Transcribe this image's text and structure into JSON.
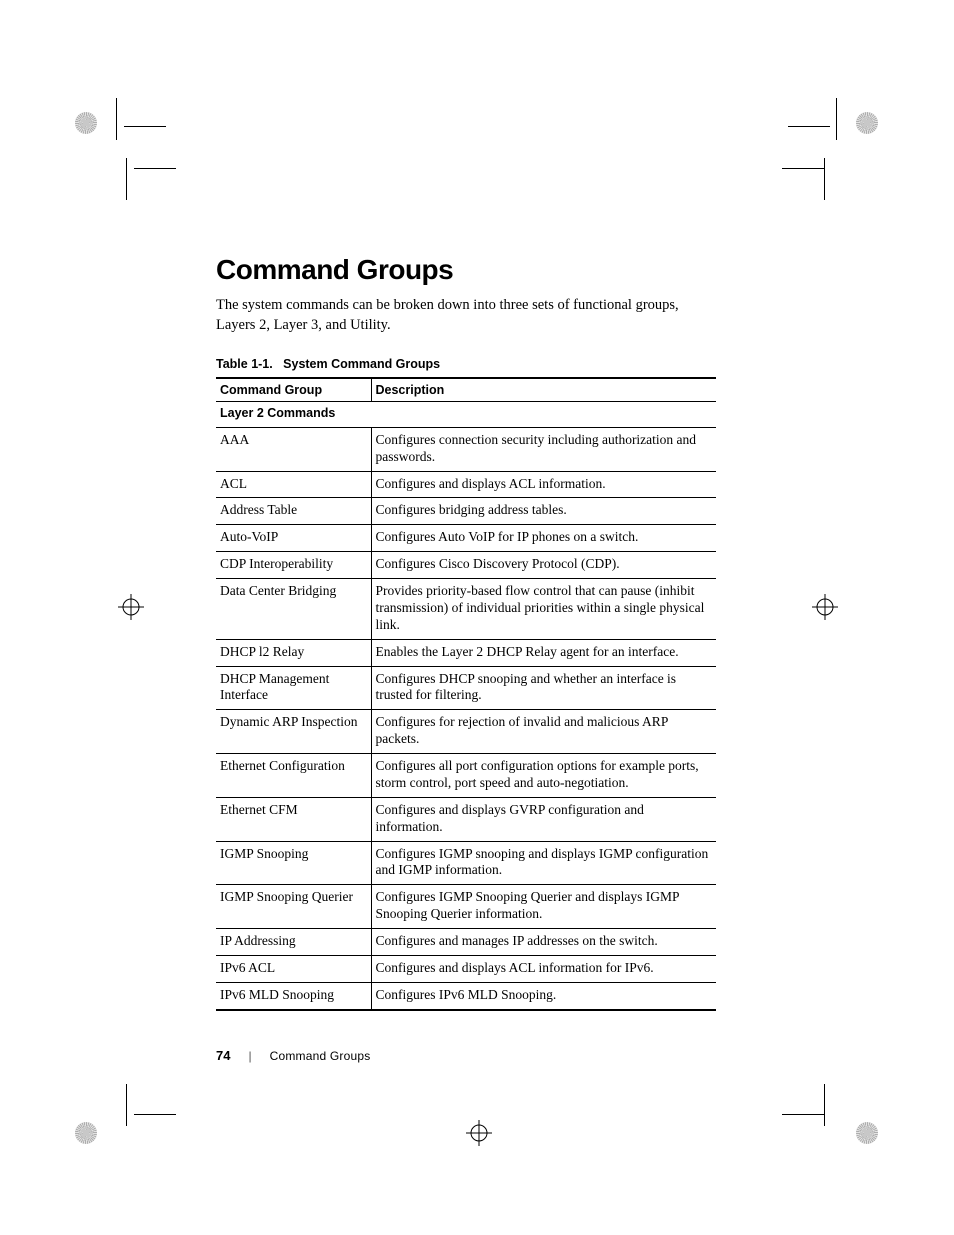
{
  "heading": "Command Groups",
  "intro": "The system commands can be broken down into three sets of functional groups, Layers 2, Layer 3, and Utility.",
  "table": {
    "caption_prefix": "Table 1-1.",
    "caption_title": "System Command Groups",
    "headers": {
      "group": "Command Group",
      "description": "Description"
    },
    "section": "Layer 2 Commands",
    "rows": [
      {
        "group": "AAA",
        "description": "Configures connection security including authorization and passwords."
      },
      {
        "group": "ACL",
        "description": "Configures and displays ACL information."
      },
      {
        "group": "Address Table",
        "description": "Configures bridging address tables."
      },
      {
        "group": "Auto-VoIP",
        "description": "Configures Auto VoIP for IP phones on a switch."
      },
      {
        "group": "CDP Interoperability",
        "description": "Configures Cisco Discovery Protocol (CDP)."
      },
      {
        "group": "Data Center Bridging",
        "description": "Provides priority-based flow control that can pause (inhibit transmission) of individual priorities within a single physical link."
      },
      {
        "group": "DHCP l2 Relay",
        "description": "Enables the Layer 2 DHCP Relay agent for an interface."
      },
      {
        "group": "DHCP Management Interface",
        "description": "Configures DHCP snooping and whether an interface is trusted for filtering."
      },
      {
        "group": "Dynamic ARP Inspection",
        "description": "Configures for rejection of invalid and malicious ARP packets."
      },
      {
        "group": "Ethernet Configuration",
        "description": "Configures all port configuration options for example ports, storm control, port speed and auto-negotiation."
      },
      {
        "group": "Ethernet CFM",
        "description": "Configures and displays GVRP configuration and information."
      },
      {
        "group": "IGMP Snooping",
        "description": "Configures IGMP snooping and displays IGMP configuration and IGMP information."
      },
      {
        "group": "IGMP Snooping Querier",
        "description": "Configures IGMP Snooping Querier and displays IGMP Snooping Querier information."
      },
      {
        "group": "IP Addressing",
        "description": "Configures and manages IP addresses on the switch."
      },
      {
        "group": "IPv6 ACL",
        "description": "Configures and displays ACL information for IPv6."
      },
      {
        "group": "IPv6 MLD Snooping",
        "description": "Configures IPv6 MLD Snooping."
      }
    ]
  },
  "footer": {
    "page_number": "74",
    "section_label": "Command Groups"
  }
}
